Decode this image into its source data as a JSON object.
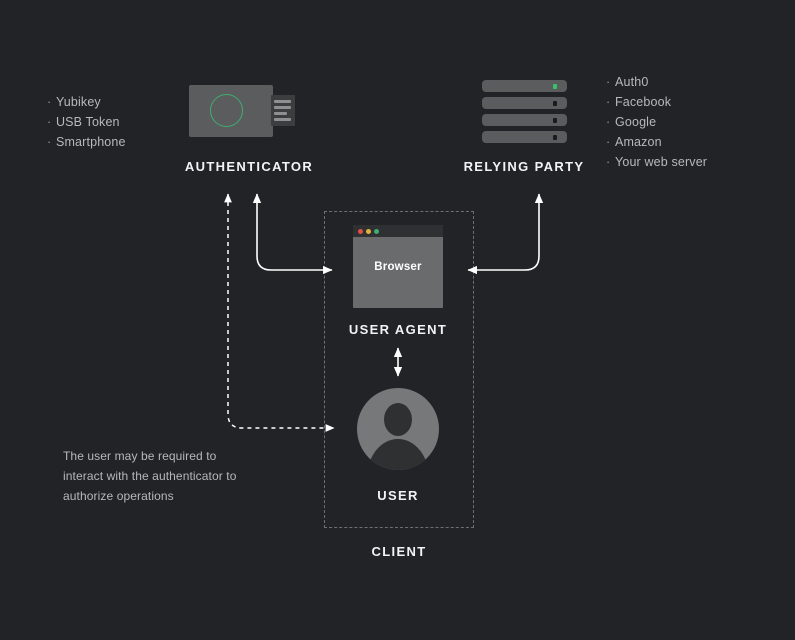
{
  "background_color": "#222326",
  "accent_green": "#3fae70",
  "left_list": {
    "name": "authenticator-examples",
    "bullet": "·",
    "items": [
      "Yubikey",
      "USB Token",
      "Smartphone"
    ]
  },
  "right_list": {
    "name": "relying-party-examples",
    "bullet": "·",
    "items": [
      "Auth0",
      "Facebook",
      "Google",
      "Amazon",
      "Your web server"
    ]
  },
  "nodes": {
    "authenticator": {
      "label": "AUTHENTICATOR",
      "icon": "usb-security-key-icon"
    },
    "relying_party": {
      "label": "RELYING PARTY",
      "icon": "server-rack-icon",
      "server_units": 4,
      "led_colors": [
        "#37c36a",
        "#1a1b1d",
        "#1a1b1d",
        "#1a1b1d"
      ]
    },
    "user_agent": {
      "label": "USER AGENT",
      "icon": "browser-window-icon",
      "window_title_text": "Browser",
      "traffic_lights": [
        "#e05243",
        "#e3b341",
        "#3fae70"
      ]
    },
    "user": {
      "label": "USER",
      "icon": "user-avatar-icon"
    },
    "client": {
      "label": "CLIENT"
    }
  },
  "annotation": {
    "name": "authenticator-interaction-note",
    "text": "The user may be required to interact with the authenticator to authorize operations"
  },
  "connectors": [
    {
      "name": "authenticator-to-user-agent-connector",
      "style": "solid",
      "direction": "bidirectional"
    },
    {
      "name": "authenticator-to-user-connector",
      "style": "dashed",
      "direction": "bidirectional"
    },
    {
      "name": "user-agent-to-relying-party-connector",
      "style": "solid",
      "direction": "bidirectional"
    },
    {
      "name": "user-to-user-agent-connector",
      "style": "solid",
      "direction": "bidirectional"
    }
  ]
}
